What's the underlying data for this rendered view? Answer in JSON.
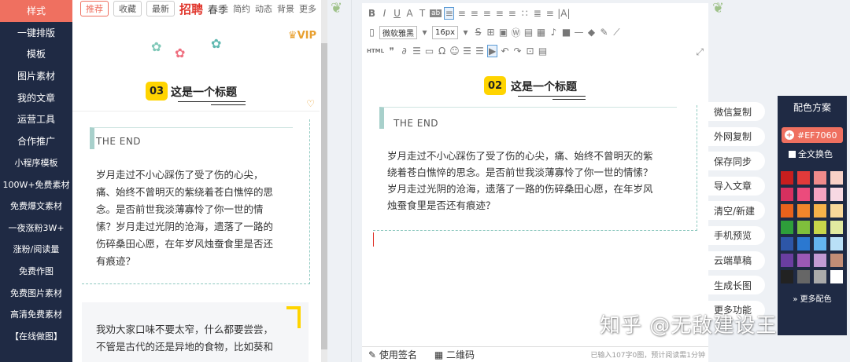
{
  "left_nav": {
    "items": [
      "样式",
      "一键排版",
      "模板",
      "图片素材",
      "我的文章",
      "运营工具",
      "合作推广",
      "小程序模板",
      "100W+免费素材",
      "免费爆文素材",
      "一夜涨粉3W+",
      "涨粉/阅读量",
      "免费作图",
      "免费图片素材",
      "高清免费素材",
      "【在线做图】"
    ],
    "active_index": 0
  },
  "template_panel": {
    "tabs": [
      "推荐",
      "收藏",
      "最新"
    ],
    "recruit": "招聘",
    "season": "春季",
    "tags": [
      "简约",
      "动态",
      "背景",
      "更多"
    ],
    "vip": "VIP",
    "card1": {
      "number": "03",
      "title": "这是一个标题"
    },
    "card2": {
      "label": "THE END",
      "lines": [
        "岁月走过不小心踩伤了受了伤的心尖，",
        "痛、始终不曾明灭的紫绕着苍白憔悴的思",
        "念。是否前世我淡薄寡怜了你一世的情",
        "愫？岁月走过光阴的沧海，遗落了一路的",
        "伤碎桑田心愿，在年岁风烛蚕食里是否还",
        "有痕迹？"
      ]
    },
    "card3": {
      "lines": [
        "我劝大家口味不要太窄，什么都要尝尝，",
        "不管是古代的还是异地的食物，比如葵和"
      ]
    }
  },
  "editor": {
    "toolbar_row1": [
      "B",
      "I",
      "U",
      "A",
      "T",
      "ab",
      "≡",
      "≡",
      "≡",
      "≡",
      "≡",
      "≡",
      "∷",
      "≣",
      "≡",
      "|A|"
    ],
    "font_family": "微软雅黑",
    "font_size": "16px",
    "toolbar_row2": [
      "S",
      "⊞",
      "▣",
      "Ⓦ",
      "▤",
      "▦",
      "♪",
      "■",
      "—",
      "◆",
      "✎",
      "⟋"
    ],
    "toolbar_row3": [
      "HTML",
      "❞",
      "∂",
      "☰",
      "▭",
      "Ω",
      "☺",
      "☰",
      "☰",
      "▶",
      "↶",
      "↷",
      "⊡",
      "▤"
    ],
    "number": "02",
    "title": "这是一个标题",
    "label": "THE END",
    "lines": [
      "岁月走过不小心踩伤了受了伤的心尖，痛、始终不曾明灭的紫",
      "绕着苍白憔悴的思念。是否前世我淡薄寡怜了你一世的情愫？",
      "岁月走过光阴的沧海，遗落了一路的伤碎桑田心愿，在年岁风",
      "烛蚕食里是否还有痕迹？"
    ],
    "footer": {
      "signature": "使用签名",
      "qrcode": "二维码",
      "status": "已输入107字0图，预计阅读需1分钟"
    }
  },
  "actions": [
    "微信复制",
    "外网复制",
    "保存同步",
    "导入文章",
    "清空/新建",
    "手机预览",
    "云端草稿",
    "生成长图",
    "更多功能"
  ],
  "color_scheme": {
    "title": "配色方案",
    "current": "#EF7060",
    "apply_all": "全文换色",
    "more": "更多配色",
    "swatches": [
      "#c81e1e",
      "#e23a3a",
      "#f08b8b",
      "#f7d1c7",
      "#d6305f",
      "#ec4b7c",
      "#f4a3c1",
      "#f7d9e3",
      "#e8621c",
      "#f2862b",
      "#f6b24a",
      "#f9d89a",
      "#2e9e3a",
      "#7fbf3c",
      "#c8d74a",
      "#e2eaa0",
      "#2d56a8",
      "#2b78d0",
      "#64b5f0",
      "#b9e0f7",
      "#6a3ea0",
      "#9b59b6",
      "#c39bd3",
      "#c28d76",
      "#222222",
      "#666666",
      "#aaaaaa",
      "#ffffff"
    ]
  },
  "watermark": "知乎 @无敌建设王"
}
